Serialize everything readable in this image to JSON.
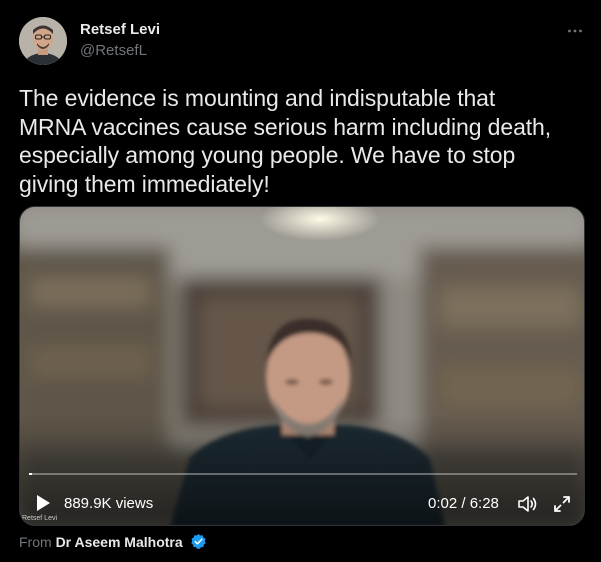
{
  "author": {
    "name": "Retsef Levi",
    "handle": "@RetsefL"
  },
  "tweet": {
    "text": "The evidence is mounting and indisputable that\nMRNA vaccines cause serious harm including death,\nespecially among young people. We have to stop\ngiving them immediately!"
  },
  "video": {
    "views": "889.9K views",
    "time": "0:02 / 6:28",
    "progress": 0.005,
    "watermark": "Retsef Levi"
  },
  "source": {
    "prefix": "From",
    "name": "Dr Aseem Malhotra"
  },
  "icons": {
    "more": "more-icon",
    "play": "play-icon",
    "volume": "volume-icon",
    "fullscreen": "fullscreen-icon",
    "verified": "verified-badge-icon"
  },
  "colors": {
    "background": "#000000",
    "text_primary": "#e7e9ea",
    "text_secondary": "#71767b",
    "verified_blue": "#1d9bf0"
  }
}
